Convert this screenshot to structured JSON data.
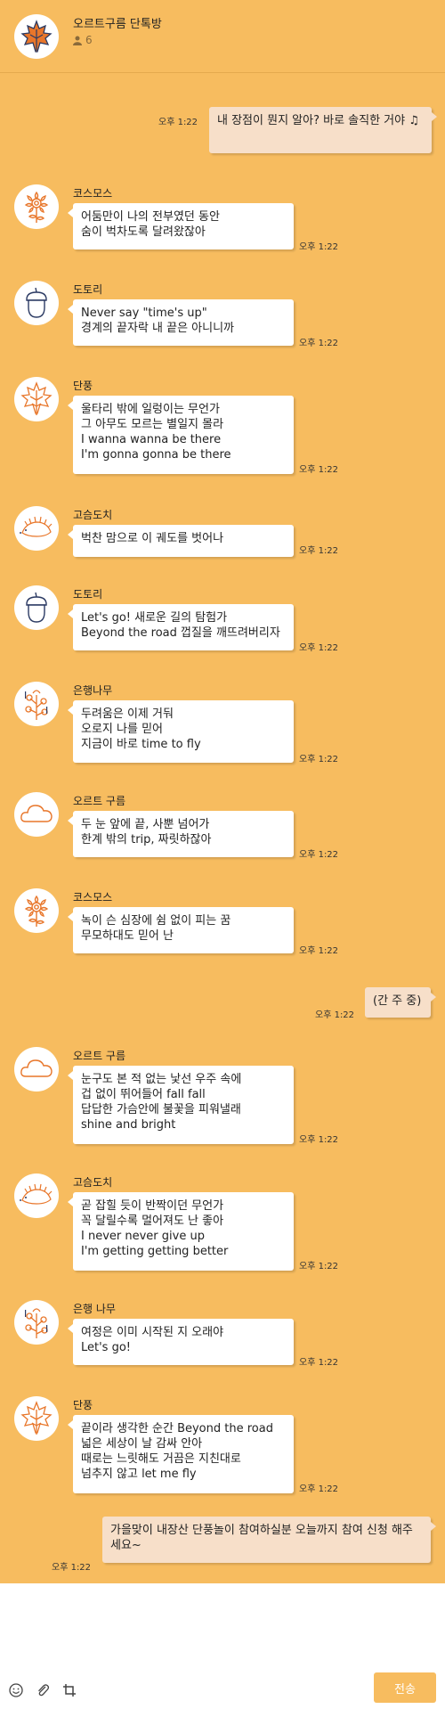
{
  "header": {
    "room_title": "오르트구름 단톡방",
    "member_count": "6"
  },
  "messages": [
    {
      "type": "out",
      "text": "내 장점이 뭔지 알아? 바로 솔직한 거야 ♫",
      "time": "오후 1:22"
    },
    {
      "type": "in",
      "sender": "코스모스",
      "avatar_icon": "cosmos-flower-icon",
      "text": "어둠만이 나의 전부였던 동안\n숨이 벅차도록 달려왔잖아",
      "time": "오후 1:22"
    },
    {
      "type": "in",
      "sender": "도토리",
      "avatar_icon": "acorn-icon",
      "text": "Never say \"time's up\"\n경계의 끝자락 내 끝은 아니니까",
      "time": "오후 1:22"
    },
    {
      "type": "in",
      "sender": "단풍",
      "avatar_icon": "maple-leaf-icon",
      "text": "울타리 밖에 일렁이는 무언가\n그 아무도 모르는 별일지 몰라\nI wanna wanna be there\nI'm gonna gonna be there",
      "time": "오후 1:22"
    },
    {
      "type": "in",
      "sender": "고슴도치",
      "avatar_icon": "hedgehog-icon",
      "text": "벅찬 맘으로 이 궤도를 벗어나",
      "time": "오후 1:22"
    },
    {
      "type": "in",
      "sender": "도토리",
      "avatar_icon": "acorn-icon",
      "text": "Let's go! 새로운 길의 탐험가\nBeyond the road 껍질을 깨뜨려버리자",
      "time": "오후 1:22"
    },
    {
      "type": "in",
      "sender": "은행나무",
      "avatar_icon": "ginkgo-tree-icon",
      "text": "두려움은 이제 거둬\n오로지 나를 믿어\n지금이 바로 time to fly",
      "time": "오후 1:22"
    },
    {
      "type": "in",
      "sender": "오르트 구름",
      "avatar_icon": "cloud-icon",
      "text": "두 눈 앞에 끝, 사뿐 넘어가\n한계 밖의 trip, 짜릿하잖아",
      "time": "오후 1:22"
    },
    {
      "type": "in",
      "sender": "코스모스",
      "avatar_icon": "cosmos-flower-icon",
      "text": "녹이 슨 심장에 쉼 없이 피는 꿈\n무모하대도 믿어 난",
      "time": "오후 1:22"
    },
    {
      "type": "out",
      "text": "(간 주 중)",
      "time": "오후 1:22"
    },
    {
      "type": "in",
      "sender": "오르트 구름",
      "avatar_icon": "cloud-icon",
      "text": "눈구도 본 적 없는 낯선 우주 속에\n겁 없이 뛰어들어 fall fall\n답답한 가슴안에 불꽃을 피워낼래\nshine and bright",
      "time": "오후 1:22"
    },
    {
      "type": "in",
      "sender": "고슴도치",
      "avatar_icon": "hedgehog-icon",
      "text": "곧 잡힐 듯이 반짝이던 무언가\n꼭 달릴수록 멀어져도 난 좋아\nI never never give up\nI'm getting getting better",
      "time": "오후 1:22"
    },
    {
      "type": "in",
      "sender": "은행 나무",
      "avatar_icon": "ginkgo-tree-icon",
      "text": "여정은 이미 시작된 지 오래야\nLet's go!",
      "time": "오후 1:22"
    },
    {
      "type": "in",
      "sender": "단풍",
      "avatar_icon": "maple-leaf-icon",
      "text": "끝이라 생각한 순간 Beyond the road\n넓은 세상이 날 감싸 안아\n때로는 느릿해도 거끔은 지친대로\n넘추지 않고 let me fly",
      "time": "오후 1:22"
    },
    {
      "type": "out",
      "text": "가을맞이 내장산 단풍놀이 참여하실분 오늘까지 참여 신청 해주세요~",
      "time": "오후 1:22"
    }
  ],
  "composer": {
    "placeholder": "",
    "send_label": "전송"
  },
  "colors": {
    "background": "#f7bc5f",
    "incoming_bubble": "#ffffff",
    "outgoing_bubble": "#f7dfc9",
    "send_button": "#f7bc5f"
  }
}
